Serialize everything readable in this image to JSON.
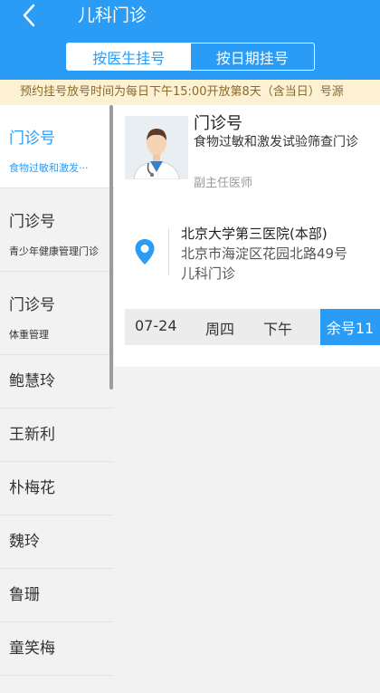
{
  "header": {
    "title": "儿科门诊",
    "back_icon": "chevron-left-icon",
    "tabs": [
      {
        "label": "按医生挂号",
        "active": true
      },
      {
        "label": "按日期挂号",
        "active": false
      }
    ]
  },
  "notice": "预约挂号放号时间为每日下午15:00开放第8天（含当日）号源",
  "sidebar": {
    "items": [
      {
        "title": "门诊号",
        "subtitle": "食物过敏和激发···",
        "active": true
      },
      {
        "title": "门诊号",
        "subtitle": "青少年健康管理门诊",
        "active": false
      },
      {
        "title": "门诊号",
        "subtitle": "体重管理",
        "active": false
      },
      {
        "title": "鲍慧玲"
      },
      {
        "title": "王新利"
      },
      {
        "title": "朴梅花"
      },
      {
        "title": "魏玲"
      },
      {
        "title": "鲁珊"
      },
      {
        "title": "童笑梅"
      }
    ]
  },
  "doctor": {
    "name": "门诊号",
    "specialty": "食物过敏和激发试验筛查门诊",
    "title": "副主任医师",
    "avatar_icon": "doctor-avatar-icon"
  },
  "location": {
    "icon": "location-pin-icon",
    "hospital": "北京大学第三医院(本部)",
    "address": "北京市海淀区花园北路49号",
    "department": "儿科门诊"
  },
  "slot": {
    "date": "07-24",
    "weekday": "周四",
    "period": "下午",
    "remaining": "余号11"
  },
  "colors": {
    "brand_blue": "#2a9cf5",
    "notice_bg": "#fcf1d2",
    "notice_text": "#8a6a2e"
  }
}
